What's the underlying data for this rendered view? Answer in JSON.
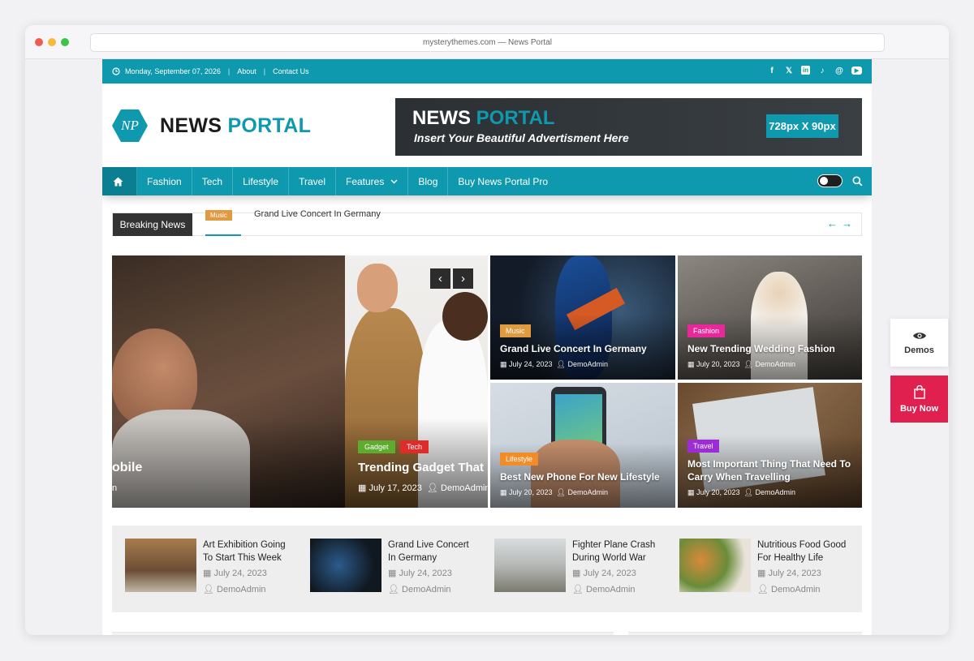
{
  "browser": {
    "url": "mysterythemes.com — News Portal"
  },
  "topbar": {
    "date": "Monday, September 07, 2026",
    "links": [
      "About",
      "Contact Us"
    ],
    "social": [
      "f",
      "𝕏",
      "in",
      "♪",
      "@",
      "▶"
    ]
  },
  "logo": {
    "mark": "NP",
    "word1": "NEWS",
    "word2": "PORTAL"
  },
  "ad": {
    "title1": "NEWS",
    "title2": "PORTAL",
    "tagline": "Insert Your Beautiful Advertisment Here",
    "size": "728px X 90px"
  },
  "nav": {
    "items": [
      "Fashion",
      "Tech",
      "Lifestyle",
      "Travel",
      "Features",
      "Blog",
      "Buy News Portal Pro"
    ]
  },
  "breaking": {
    "label": "Breaking News",
    "tag": "Music",
    "text": "Grand Live Concert In Germany"
  },
  "slider": {
    "left": {
      "title": "obile",
      "meta": "n"
    },
    "main": {
      "tags": [
        "Gadget",
        "Tech"
      ],
      "title": "Trending Gadget That S",
      "date": "July 17, 2023",
      "author": "DemoAdmin"
    }
  },
  "grid": [
    {
      "tag": "Music",
      "tag_color": "#e09a3f",
      "title": "Grand Live Concert In Germany",
      "date": "July 24, 2023",
      "author": "DemoAdmin"
    },
    {
      "tag": "Fashion",
      "tag_color": "#e8279b",
      "title": "New Trending Wedding Fashion",
      "date": "July 20, 2023",
      "author": "DemoAdmin"
    },
    {
      "tag": "Lifestyle",
      "tag_color": "#f28c28",
      "title": "Best New Phone For New Lifestyle",
      "date": "July 20, 2023",
      "author": "DemoAdmin"
    },
    {
      "tag": "Travel",
      "tag_color": "#9b2cd6",
      "title": "Most Important Thing That Need To Carry When Travelling",
      "date": "July 20, 2023",
      "author": "DemoAdmin"
    }
  ],
  "strip": [
    {
      "title": "Art Exhibition Going To Start This Week",
      "date": "July 24, 2023",
      "author": "DemoAdmin"
    },
    {
      "title": "Grand Live Concert In Germany",
      "date": "July 24, 2023",
      "author": "DemoAdmin"
    },
    {
      "title": "Fighter Plane Crash During World War",
      "date": "July 24, 2023",
      "author": "DemoAdmin"
    },
    {
      "title": "Nutritious Food Good For Healthy Life",
      "date": "July 24, 2023",
      "author": "DemoAdmin"
    }
  ],
  "side": {
    "demos": "Demos",
    "buy": "Buy Now"
  },
  "colors": {
    "accent": "#0e99ae",
    "buy": "#e0204e"
  }
}
